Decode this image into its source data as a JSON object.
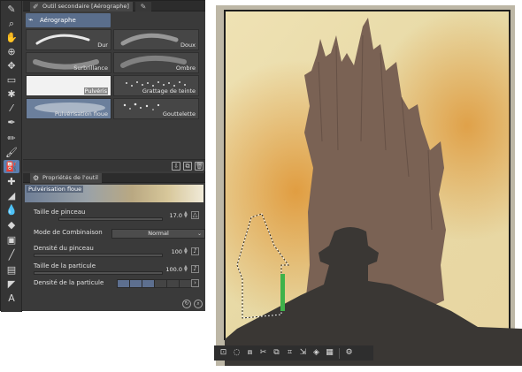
{
  "sub_tool_panel": {
    "title": "Outil secondaire [Aérographe]",
    "group": "Aérographe",
    "brushes": [
      {
        "label": "Dur"
      },
      {
        "label": "Doux"
      },
      {
        "label": "Surbrillance"
      },
      {
        "label": "Ombre"
      },
      {
        "label": "Pulvéris"
      },
      {
        "label": "Grattage de teinte"
      },
      {
        "label": "Pulvérisation floue"
      },
      {
        "label": "Gouttelette"
      }
    ],
    "selected_brush": "Pulvérisation floue"
  },
  "tool_properties": {
    "title": "Propriétés de l'outil",
    "preview_name": "Pulvérisation floue",
    "brush_size": {
      "label": "Taille de pinceau",
      "value": "17.0",
      "level": 0.17
    },
    "blend_mode": {
      "label": "Mode de Combinaison",
      "value": "Normal"
    },
    "brush_density": {
      "label": "Densité du pinceau",
      "value": "100",
      "level": 1.0
    },
    "particle_size": {
      "label": "Taille de la particule",
      "value": "100.0",
      "level": 1.0
    },
    "particle_density": {
      "label": "Densité de la particule",
      "filled": 3,
      "total": 6
    }
  },
  "toolbar_icons": [
    "pen-icon",
    "zoom-icon",
    "hand-icon",
    "zoom-move-icon",
    "move-icon",
    "selection-icon",
    "magic-wand-icon",
    "eyedropper-icon",
    "pen-tool-icon",
    "pencil-icon",
    "brush-icon",
    "airbrush-icon",
    "decoration-icon",
    "eraser-icon",
    "blend-icon",
    "fill-icon",
    "gradient-icon",
    "figure-icon",
    "frame-icon",
    "ruler-icon",
    "text-icon",
    "balloon-icon"
  ],
  "colors": {
    "panel_bg": "#3b3b3b",
    "accent": "#5a7fb0",
    "canvas_sky": "#e9dcaa",
    "canvas_orange": "#e0a14a",
    "tower": "#7a6254",
    "silhouette": "#3a3734",
    "selection_green": "#3fb24a"
  }
}
